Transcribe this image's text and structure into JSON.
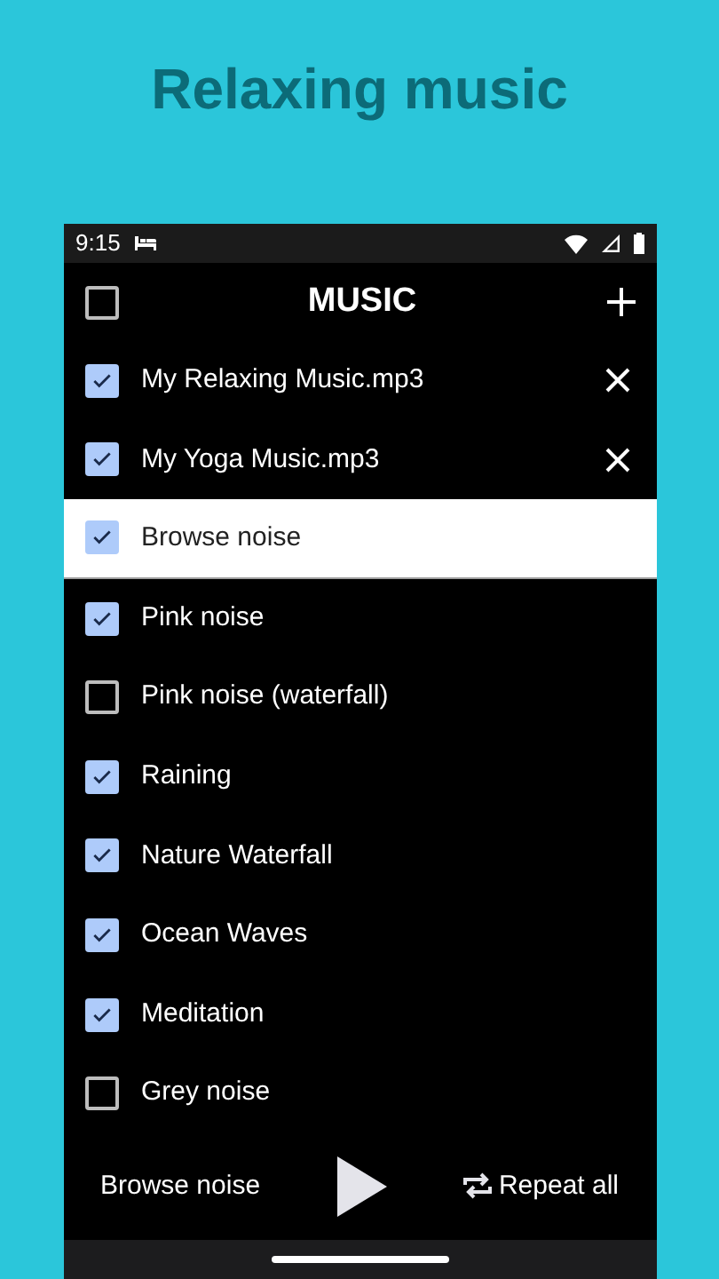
{
  "headline": "Relaxing music",
  "status_bar": {
    "time": "9:15"
  },
  "dialog": {
    "title": "MUSIC",
    "select_all_checked": false,
    "items": [
      {
        "label": "My Relaxing Music.mp3",
        "kind": "file",
        "checked": true,
        "selected": false
      },
      {
        "label": "My Yoga Music.mp3",
        "kind": "file",
        "checked": true,
        "selected": false
      },
      {
        "label": "Browse noise",
        "kind": "noise",
        "checked": true,
        "selected": true
      },
      {
        "label": "Pink noise",
        "kind": "noise",
        "checked": true,
        "selected": false
      },
      {
        "label": "Pink noise (waterfall)",
        "kind": "noise",
        "checked": false,
        "selected": false
      },
      {
        "label": "Raining",
        "kind": "noise",
        "checked": true,
        "selected": false
      },
      {
        "label": "Nature Waterfall",
        "kind": "noise",
        "checked": true,
        "selected": false
      },
      {
        "label": "Ocean Waves",
        "kind": "noise",
        "checked": true,
        "selected": false
      },
      {
        "label": "Meditation",
        "kind": "noise",
        "checked": true,
        "selected": false
      },
      {
        "label": "Grey noise",
        "kind": "noise",
        "checked": false,
        "selected": false
      }
    ],
    "now_playing": "Browse noise",
    "repeat": "Repeat all"
  }
}
